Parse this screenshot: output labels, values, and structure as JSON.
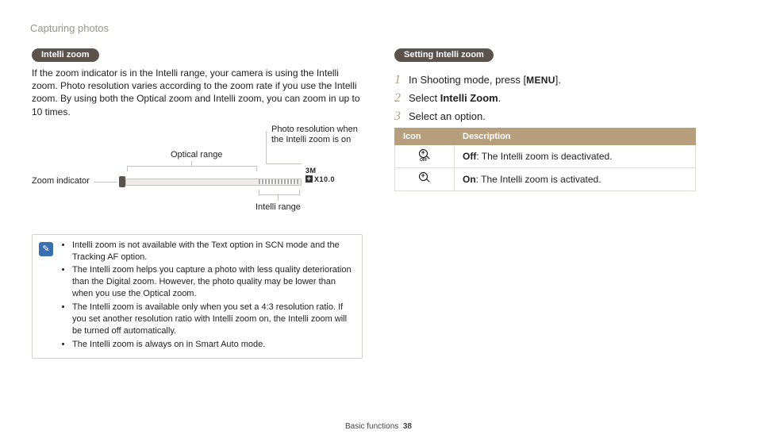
{
  "header": {
    "running": "Capturing photos"
  },
  "left": {
    "pill": "Intelli zoom",
    "paragraph": "If the zoom indicator is in the Intelli range, your camera is using the Intelli zoom. Photo resolution varies according to the zoom rate if you use the Intelli zoom. By using both the Optical zoom and Intelli zoom, you can zoom in up to 10 times.",
    "diagram": {
      "zoom_indicator": "Zoom indicator",
      "optical_range": "Optical range",
      "intelli_range": "Intelli range",
      "photo_res_on": "Photo resolution when the Intelli zoom is on",
      "res_top": "3M",
      "res_bottom": "X10.0"
    },
    "notes": {
      "b1": "Intelli zoom is not available with the Text option in SCN mode and the Tracking AF option.",
      "b2": "The Intelli zoom helps you capture a photo with less quality deterioration than the Digital zoom. However, the photo quality may be lower than when you use the Optical zoom.",
      "b3": "The Intelli zoom is available only when you set a 4:3 resolution ratio. If you set another resolution ratio with Intelli zoom on, the Intelli zoom will be turned off automatically.",
      "b4": "The Intelli zoom is always on in Smart Auto mode."
    }
  },
  "right": {
    "pill": "Setting Intelli zoom",
    "steps": {
      "n1": "1",
      "t1_pre": "In Shooting mode, press [",
      "t1_menu": "MENU",
      "t1_post": "].",
      "n2": "2",
      "t2_pre": "Select ",
      "t2_bold": "Intelli Zoom",
      "t2_post": ".",
      "n3": "3",
      "t3": "Select an option."
    },
    "table": {
      "head_icon": "Icon",
      "head_desc": "Description",
      "r1_bold": "Off",
      "r1_rest": ": The Intelli zoom is deactivated.",
      "r2_bold": "On",
      "r2_rest": ": The Intelli zoom is activated."
    }
  },
  "footer": {
    "section": "Basic functions",
    "page": "38"
  }
}
